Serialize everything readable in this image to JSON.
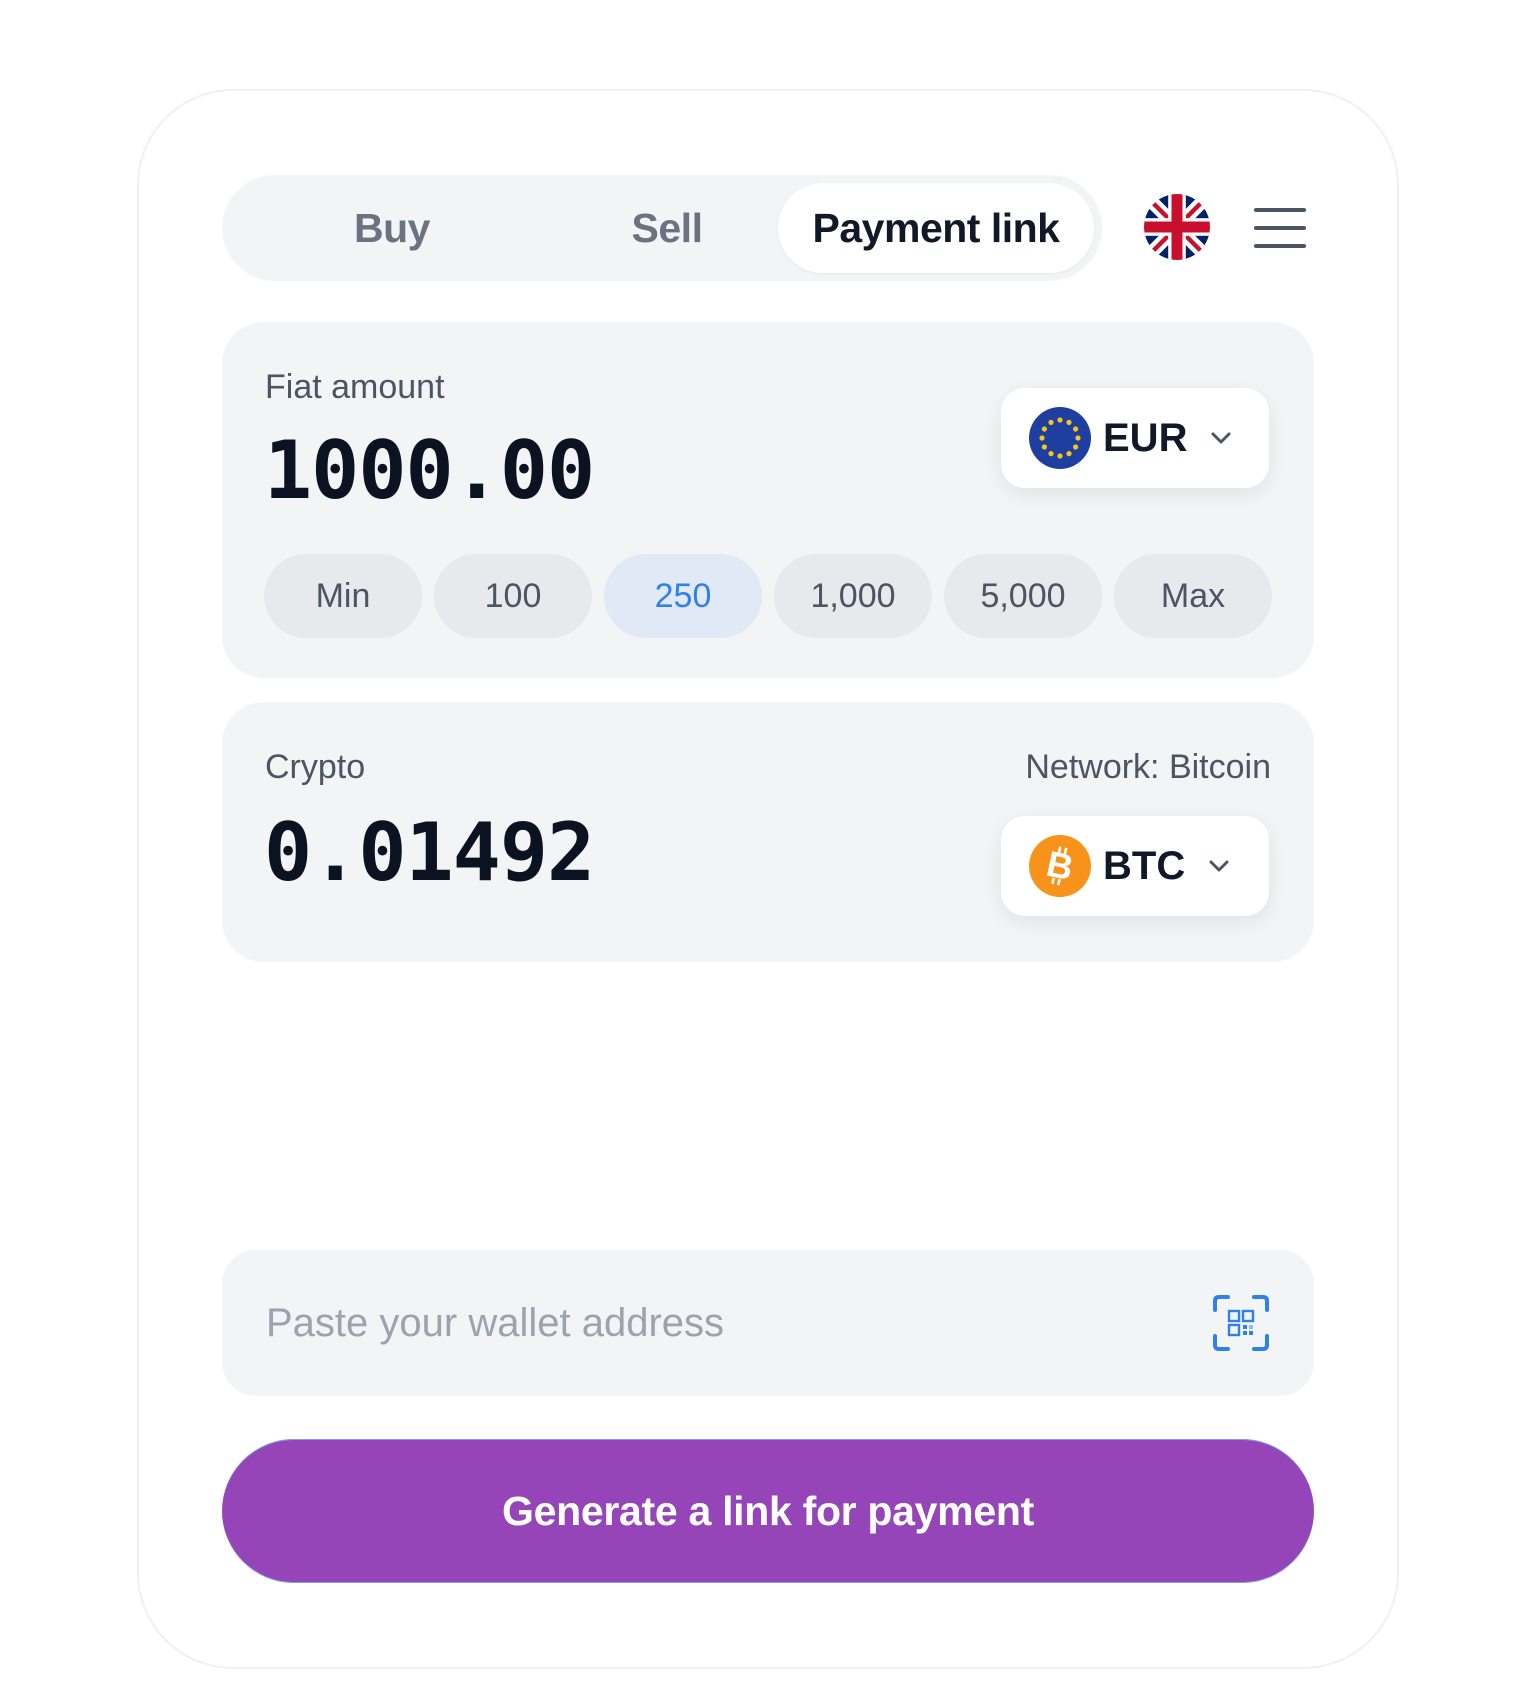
{
  "tabs": [
    {
      "label": "Buy",
      "active": false
    },
    {
      "label": "Sell",
      "active": false
    },
    {
      "label": "Payment link",
      "active": true
    }
  ],
  "language": {
    "icon": "uk-flag-icon"
  },
  "menu": {
    "icon": "hamburger-menu-icon"
  },
  "fiat": {
    "label": "Fiat amount",
    "amount": "1000.00",
    "currency": {
      "code": "EUR",
      "icon": "eu-flag-icon"
    },
    "quick_amounts": [
      "Min",
      "100",
      "250",
      "1,000",
      "5,000",
      "Max"
    ],
    "selected_quick_amount": "250"
  },
  "crypto": {
    "label": "Crypto",
    "network": "Network: Bitcoin",
    "amount": "0.01492",
    "currency": {
      "code": "BTC",
      "icon": "bitcoin-icon"
    }
  },
  "wallet": {
    "placeholder": "Paste your wallet address",
    "value": "",
    "scan_icon": "qr-scan-icon"
  },
  "cta": {
    "label": "Generate a link for payment"
  },
  "colors": {
    "accent": "#9645b9",
    "chip_active_text": "#2f80ed",
    "chip_active_bg": "#e1e9f7",
    "panel_bg": "#f3f4f6"
  }
}
